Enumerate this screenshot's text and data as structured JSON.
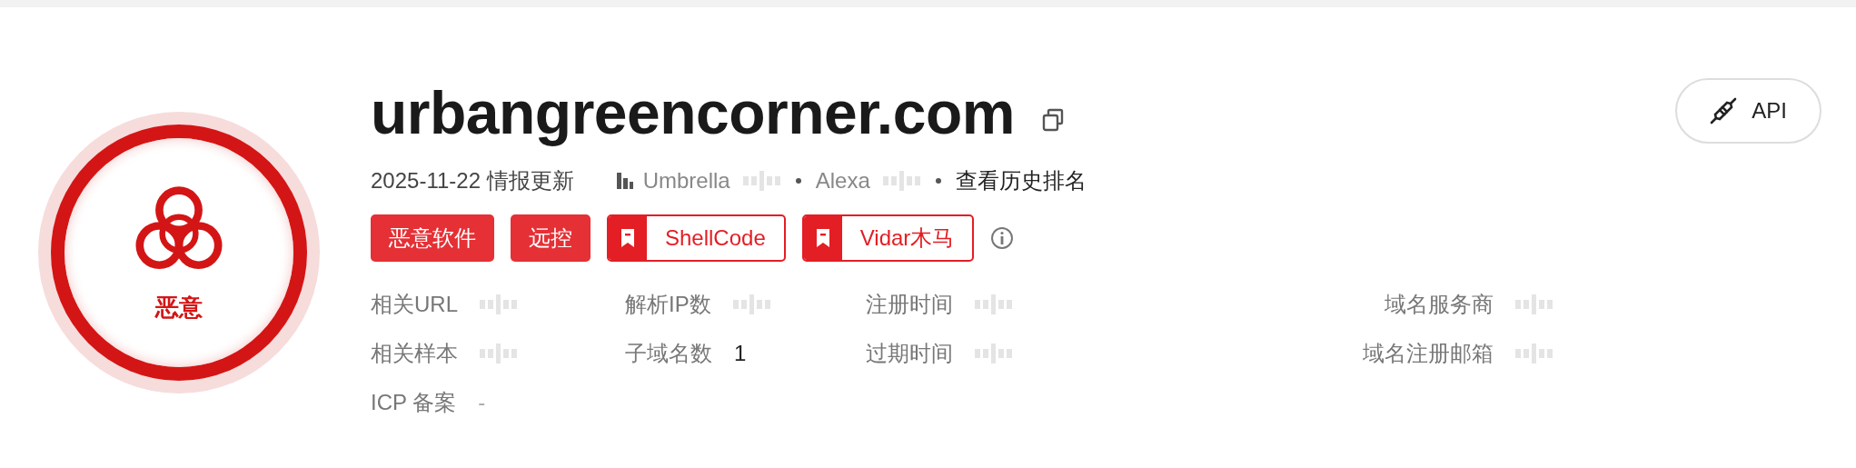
{
  "verdict": {
    "label": "恶意"
  },
  "domain": "urbangreencorner.com",
  "updated": "2025-11-22 情报更新",
  "rankings": [
    {
      "name": "Umbrella",
      "masked": true
    },
    {
      "name": "Alexa",
      "masked": true
    }
  ],
  "history_link": "查看历史排名",
  "tags": [
    {
      "label": "恶意软件",
      "kind": "solid"
    },
    {
      "label": "远控",
      "kind": "solid"
    },
    {
      "label": "ShellCode",
      "kind": "bookmark"
    },
    {
      "label": "Vidar木马",
      "kind": "bookmark"
    }
  ],
  "api_button": "API",
  "field_rows": [
    [
      {
        "label": "相关URL",
        "masked": true
      },
      {
        "label": "解析IP数",
        "masked": true
      },
      {
        "label": "注册时间",
        "masked": true
      },
      {
        "label": "域名服务商",
        "masked": true
      }
    ],
    [
      {
        "label": "相关样本",
        "masked": true
      },
      {
        "label": "子域名数",
        "masked": false,
        "value": "1"
      },
      {
        "label": "过期时间",
        "masked": true
      },
      {
        "label": "域名注册邮箱",
        "masked": true
      }
    ],
    [
      {
        "label": "ICP 备案",
        "masked": false,
        "value": "-"
      }
    ]
  ]
}
